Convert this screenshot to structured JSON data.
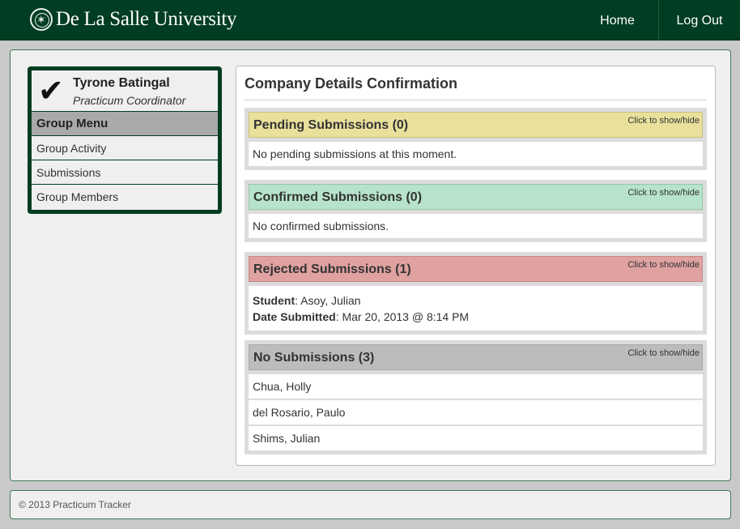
{
  "header": {
    "brand": "De La Salle University",
    "nav": {
      "home": "Home",
      "logout": "Log Out"
    }
  },
  "profile": {
    "name": "Tyrone Batingal",
    "role": "Practicum Coordinator"
  },
  "sidebar": {
    "menu_title": "Group Menu",
    "items": [
      {
        "label": "Group Activity"
      },
      {
        "label": "Submissions"
      },
      {
        "label": "Group Members"
      }
    ]
  },
  "main": {
    "title": "Company Details Confirmation",
    "toggle_label": "Click to show/hide",
    "sections": {
      "pending": {
        "title": "Pending Submissions (0)",
        "message": "No pending submissions at this moment.",
        "color": "#e8e09b"
      },
      "confirmed": {
        "title": "Confirmed Submissions (0)",
        "message": "No confirmed submissions.",
        "color": "#b6e3c9"
      },
      "rejected": {
        "title": "Rejected Submissions (1)",
        "student_label": "Student",
        "student_value": ": Asoy, Julian",
        "date_label": "Date Submitted",
        "date_value": ": Mar 20, 2013 @ 8:14 PM",
        "color": "#e0a1a1"
      },
      "nosub": {
        "title": "No Submissions (3)",
        "students": [
          "Chua, Holly",
          "del Rosario, Paulo",
          "Shims, Julian"
        ],
        "color": "#bcbcbc"
      }
    }
  },
  "footer": {
    "text": "© 2013 Practicum Tracker"
  }
}
